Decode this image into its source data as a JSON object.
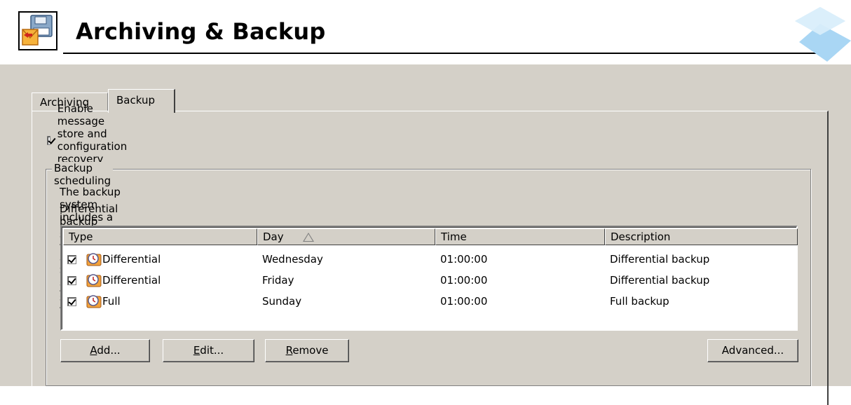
{
  "header": {
    "title": "Archiving & Backup",
    "icon": "backup-floppy-icon"
  },
  "tabs": [
    {
      "label": "Archiving",
      "active": false
    },
    {
      "label": "Backup",
      "active": true
    }
  ],
  "enable_backup": {
    "label": "Enable message store and configuration recovery backup",
    "checked": true
  },
  "scheduling": {
    "group_label": "Backup scheduling",
    "description_line1": "The backup system includes a basic backup (full backup) and one advanced type of backup (differential).",
    "description_line2": "Differential backup stores only files changed or newly created since last full backup.",
    "columns": [
      "Type",
      "Day",
      "Time",
      "Description"
    ],
    "sort_column": "Day",
    "rows": [
      {
        "enabled": true,
        "type": "Differential",
        "day": "Wednesday",
        "time": "01:00:00",
        "description": "Differential backup"
      },
      {
        "enabled": true,
        "type": "Differential",
        "day": "Friday",
        "time": "01:00:00",
        "description": "Differential backup"
      },
      {
        "enabled": true,
        "type": "Full",
        "day": "Sunday",
        "time": "01:00:00",
        "description": "Full backup"
      }
    ]
  },
  "buttons": {
    "add": {
      "mnemonic": "A",
      "rest": "dd..."
    },
    "edit": {
      "mnemonic": "E",
      "rest": "dit..."
    },
    "remove": {
      "mnemonic": "R",
      "rest": "emove"
    },
    "advanced": {
      "label": "Advanced..."
    }
  },
  "colors": {
    "dialog_bg": "#d4d0c8",
    "list_bg": "#ffffff",
    "header_bg": "#ffffff"
  }
}
